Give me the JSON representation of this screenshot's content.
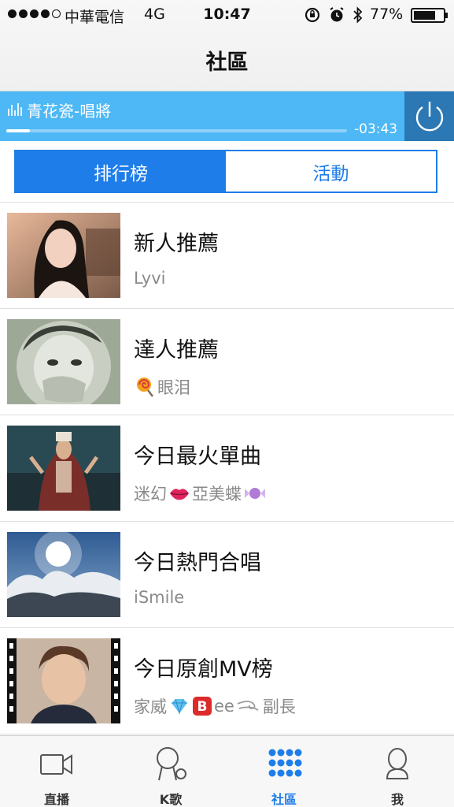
{
  "status_bar": {
    "carrier": "中華電信",
    "network": "4G",
    "time": "10:47",
    "battery_percent": "77%",
    "signal_bars_filled": 4,
    "signal_bars_total": 5
  },
  "nav": {
    "title": "社區"
  },
  "player": {
    "song": "青花瓷-唱將",
    "remaining": "-03:43",
    "progress_fraction": 0.07,
    "power_icon": "power-icon"
  },
  "segments": [
    {
      "label": "排行榜",
      "selected": true
    },
    {
      "label": "活動",
      "selected": false
    }
  ],
  "list": [
    {
      "title": "新人推薦",
      "sub_parts": [
        "Lyvi"
      ]
    },
    {
      "title": "達人推薦",
      "sub_parts": [
        "眼泪"
      ],
      "sub_prefix_icon": "lollipop-icon"
    },
    {
      "title": "今日最火單曲",
      "sub_parts": [
        "迷幻",
        "亞美蝶"
      ],
      "icons": [
        "lips-icon",
        "candy-icon"
      ]
    },
    {
      "title": "今日熱門合唱",
      "sub_parts": [
        "iSmile"
      ]
    },
    {
      "title": "今日原創MV榜",
      "sub_parts": [
        "家威",
        "ee",
        "副長"
      ],
      "icons": [
        "gem-icon",
        "b-badge-icon",
        "wind-icon"
      ]
    }
  ],
  "tabs": [
    {
      "label": "直播",
      "icon": "video-camera-icon",
      "selected": false
    },
    {
      "label": "K歌",
      "icon": "microphone-icon",
      "selected": false
    },
    {
      "label": "社區",
      "icon": "grid-dots-icon",
      "selected": true
    },
    {
      "label": "我",
      "icon": "person-icon",
      "selected": false
    }
  ],
  "colors": {
    "accent": "#1e7de8",
    "player_bg": "#4db8f5",
    "player_power_bg": "#2b78b4"
  }
}
